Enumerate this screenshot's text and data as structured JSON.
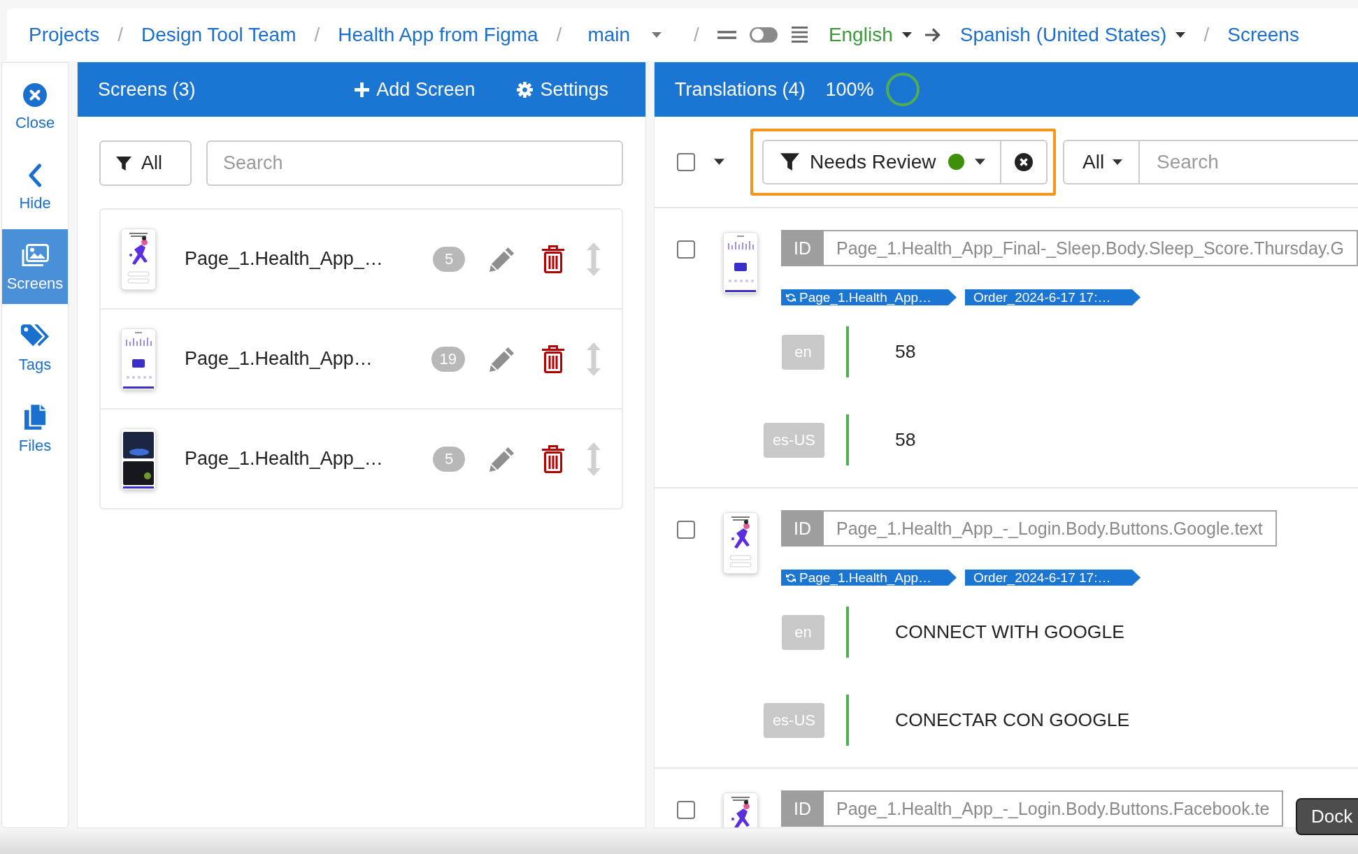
{
  "breadcrumb": [
    {
      "kind": "link",
      "text": "Projects"
    },
    {
      "kind": "separator",
      "text": "/"
    },
    {
      "kind": "link",
      "text": "Design Tool Team"
    },
    {
      "kind": "separator",
      "text": "/"
    },
    {
      "kind": "link",
      "text": "Health App from Figma"
    },
    {
      "kind": "separator",
      "text": "/"
    },
    {
      "kind": "dropdown",
      "text": "main"
    },
    {
      "kind": "separator",
      "text": "/"
    },
    {
      "kind": "view-switch",
      "on": false
    },
    {
      "kind": "language-pair",
      "source": "English",
      "target": "Spanish (United States)"
    },
    {
      "kind": "separator",
      "text": "/"
    },
    {
      "kind": "link",
      "text": "Screens"
    }
  ],
  "sidebar": {
    "items": [
      {
        "kind": "close",
        "label": "Close",
        "selected": false
      },
      {
        "kind": "hide",
        "label": "Hide",
        "selected": false
      },
      {
        "kind": "screens",
        "label": "Screens",
        "selected": true
      },
      {
        "kind": "tags",
        "label": "Tags",
        "selected": false
      },
      {
        "kind": "files",
        "label": "Files",
        "selected": false
      }
    ]
  },
  "screens_panel": {
    "title": "Screens (3)",
    "add_button": "Add Screen",
    "settings_button": "Settings",
    "filter_button": "All",
    "search": {
      "placeholder": "Search"
    },
    "screens": [
      {
        "kind": "figure",
        "name": "Page_1.Health_App_…",
        "count": "5"
      },
      {
        "kind": "chart",
        "name": "Page_1.Health_App…",
        "count": "19"
      },
      {
        "kind": "dark",
        "name": "Page_1.Health_App_…",
        "count": "5"
      }
    ]
  },
  "translations_panel": {
    "title": "Translations (4)",
    "progress": {
      "text": "100%",
      "level": 1
    },
    "select_all": {
      "checked": false
    },
    "status_filter": {
      "label": "Needs Review",
      "highlighted": true
    },
    "language_filter": "All",
    "search": {
      "placeholder": "Search"
    },
    "items": [
      {
        "kind": "chart",
        "checked": false,
        "id_label": "ID",
        "id": "Page_1.Health_App_Final-_Sleep.Body.Sleep_Score.Thursday.G",
        "tags": [
          {
            "kind": "screen",
            "text": "Page_1.Health_App…"
          },
          {
            "kind": "order",
            "text": "Order_2024-6-17 17:…"
          }
        ],
        "entries": [
          {
            "lang": "en",
            "text": "58"
          },
          {
            "lang": "es-US",
            "text": "58"
          }
        ]
      },
      {
        "kind": "figure",
        "checked": false,
        "id_label": "ID",
        "id": "Page_1.Health_App_-_Login.Body.Buttons.Google.text",
        "tags": [
          {
            "kind": "screen",
            "text": "Page_1.Health_App…"
          },
          {
            "kind": "order",
            "text": "Order_2024-6-17 17:…"
          }
        ],
        "entries": [
          {
            "lang": "en",
            "text": "CONNECT WITH GOOGLE"
          },
          {
            "lang": "es-US",
            "text": "CONECTAR CON GOOGLE"
          }
        ]
      },
      {
        "kind": "figure",
        "checked": false,
        "id_label": "ID",
        "id": "Page_1.Health_App_-_Login.Body.Buttons.Facebook.te"
      }
    ]
  },
  "dock_button": "Dock"
}
